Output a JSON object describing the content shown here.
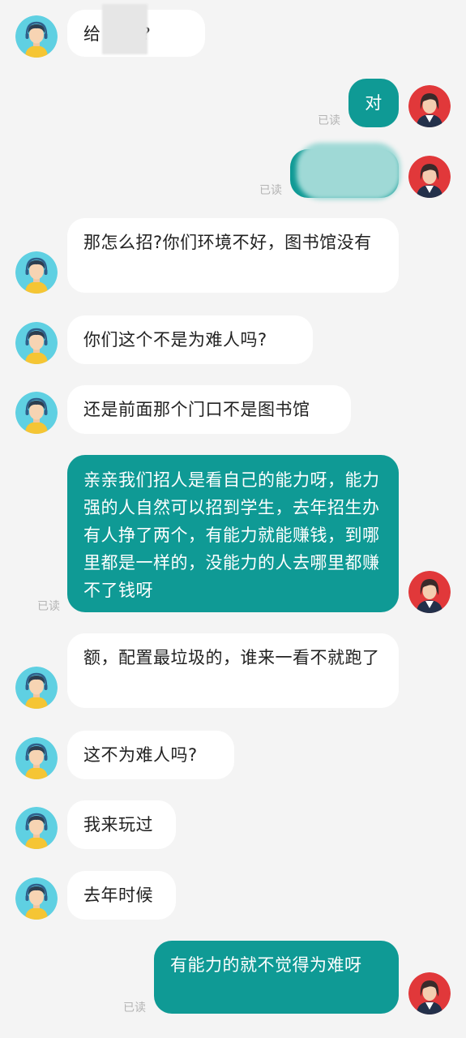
{
  "read_label": "已读",
  "messages": [
    {
      "side": "in",
      "text": "给    招生?"
    },
    {
      "side": "out",
      "text": "对"
    },
    {
      "side": "out",
      "text": ""
    },
    {
      "side": "in",
      "text": "那怎么招?你们环境不好，图书馆没有"
    },
    {
      "side": "in",
      "text": "你们这个不是为难人吗?"
    },
    {
      "side": "in",
      "text": "还是前面那个门口不是图书馆"
    },
    {
      "side": "out",
      "text": "亲亲我们招人是看自己的能力呀，能力强的人自然可以招到学生，去年招生办有人挣了两个，有能力就能赚钱，到哪里都是一样的，没能力的人去哪里都赚不了钱呀"
    },
    {
      "side": "in",
      "text": "额，配置最垃圾的，谁来一看不就跑了"
    },
    {
      "side": "in",
      "text": "这不为难人吗?"
    },
    {
      "side": "in",
      "text": "我来玩过"
    },
    {
      "side": "in",
      "text": "去年时候"
    },
    {
      "side": "out",
      "text": "有能力的就不觉得为难呀"
    }
  ],
  "colors": {
    "accent": "#0f9a95",
    "background": "#f4f4f4",
    "bubble_in": "#ffffff"
  }
}
